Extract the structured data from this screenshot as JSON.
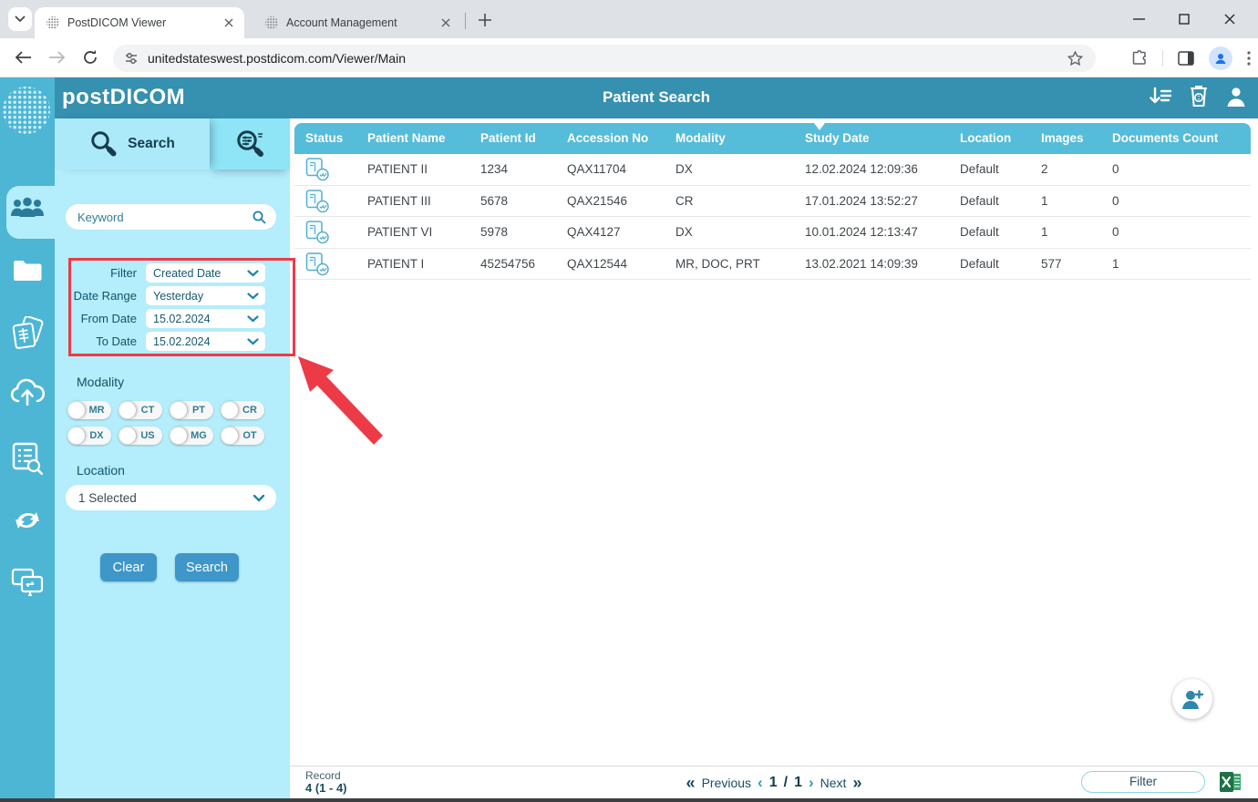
{
  "browser": {
    "tabs": [
      {
        "title": "PostDICOM Viewer"
      },
      {
        "title": "Account Management"
      }
    ],
    "url": "unitedstateswest.postdicom.com/Viewer/Main"
  },
  "app_header": {
    "logo": "postDICOM",
    "title": "Patient Search"
  },
  "search_panel": {
    "search_tab_label": "Search",
    "keyword_placeholder": "Keyword",
    "filter_rows": [
      {
        "label": "Filter",
        "value": "Created Date"
      },
      {
        "label": "Date Range",
        "value": "Yesterday"
      },
      {
        "label": "From Date",
        "value": "15.02.2024"
      },
      {
        "label": "To Date",
        "value": "15.02.2024"
      }
    ],
    "modality_label": "Modality",
    "modalities": [
      "MR",
      "CT",
      "PT",
      "CR",
      "DX",
      "US",
      "MG",
      "OT"
    ],
    "location_label": "Location",
    "location_value": "1 Selected",
    "clear_button": "Clear",
    "search_button": "Search"
  },
  "table": {
    "columns": {
      "status": "Status",
      "patient_name": "Patient Name",
      "patient_id": "Patient Id",
      "accession_no": "Accession No",
      "modality": "Modality",
      "study_date": "Study Date",
      "location": "Location",
      "images": "Images",
      "documents_count": "Documents Count"
    },
    "sorted_by": "Study Date",
    "rows": [
      {
        "patient_name": "PATIENT II",
        "patient_id": "1234",
        "accession_no": "QAX11704",
        "modality": "DX",
        "study_date": "12.02.2024 12:09:36",
        "location": "Default",
        "images": "2",
        "documents_count": "0"
      },
      {
        "patient_name": "PATIENT III",
        "patient_id": "5678",
        "accession_no": "QAX21546",
        "modality": "CR",
        "study_date": "17.01.2024 13:52:27",
        "location": "Default",
        "images": "1",
        "documents_count": "0"
      },
      {
        "patient_name": "PATIENT VI",
        "patient_id": "5978",
        "accession_no": "QAX4127",
        "modality": "DX",
        "study_date": "10.01.2024 12:13:47",
        "location": "Default",
        "images": "1",
        "documents_count": "0"
      },
      {
        "patient_name": "PATIENT I",
        "patient_id": "45254756",
        "accession_no": "QAX12544",
        "modality": "MR, DOC, PRT",
        "study_date": "13.02.2021 14:09:39",
        "location": "Default",
        "images": "577",
        "documents_count": "1"
      }
    ]
  },
  "footer": {
    "record_label": "Record",
    "record_value": "4 (1 - 4)",
    "first_icon": "«",
    "previous_label": "Previous",
    "prev_chevron": "‹",
    "page_current": "1",
    "page_separator": "/",
    "page_total": "1",
    "next_chevron": "›",
    "next_label": "Next",
    "last_icon": "»",
    "filter_button": "Filter"
  },
  "colors": {
    "header_teal": "#3690b0",
    "sidebar_cyan": "#4db6d4",
    "panel_cyan": "#b4edfb",
    "table_header_cyan": "#55bcd9",
    "button_blue": "#3f96c8",
    "annotation_red": "#ec3b47",
    "excel_green": "#1e7145"
  }
}
